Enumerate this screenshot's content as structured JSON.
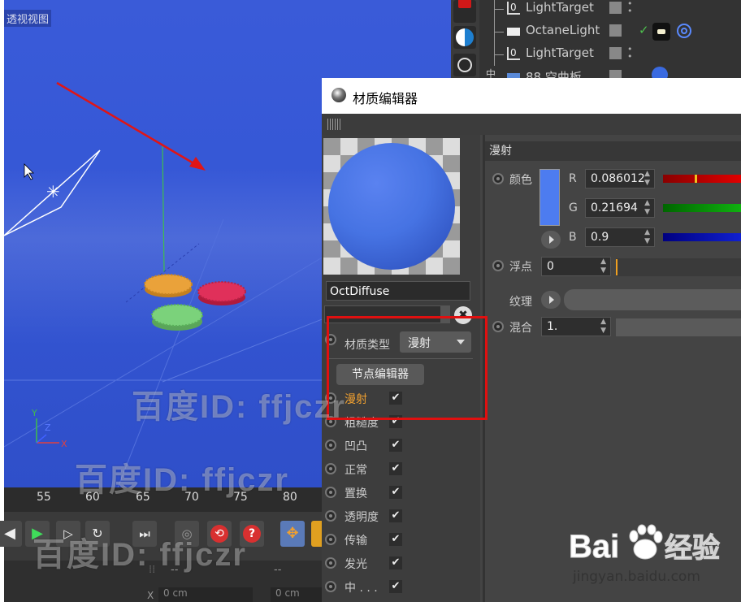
{
  "viewport": {
    "title": "透视视图"
  },
  "timeline": {
    "ticks": [
      "55",
      "60",
      "65",
      "70",
      "75",
      "80"
    ]
  },
  "coords": {
    "x_label": "X",
    "x_value": "0 cm",
    "y_value": "0 cm",
    "dash1": "--",
    "dash2": "--"
  },
  "object_manager": {
    "rows": [
      {
        "label": "LightTarget"
      },
      {
        "label": "OctaneLight"
      },
      {
        "label": "LightTarget"
      },
      {
        "label": "88 空曲板"
      }
    ]
  },
  "material_editor": {
    "title": "材质编辑器",
    "material_name": "OctDiffuse",
    "material_type_label": "材质类型",
    "material_type_value": "漫射",
    "node_editor_button": "节点编辑器",
    "channels": [
      {
        "label": "漫射",
        "checked": "✔"
      },
      {
        "label": "粗糙度",
        "checked": "✔"
      },
      {
        "label": "凹凸",
        "checked": "✔"
      },
      {
        "label": "正常",
        "checked": "✔"
      },
      {
        "label": "置换",
        "checked": "✔"
      },
      {
        "label": "透明度",
        "checked": "✔"
      },
      {
        "label": "传输",
        "checked": "✔"
      },
      {
        "label": "发光",
        "checked": "✔"
      },
      {
        "label": "中 . . .",
        "checked": "✔"
      }
    ],
    "section_title": "漫射",
    "color_label": "颜色",
    "r_label": "R",
    "r_value": "0.086012",
    "g_label": "G",
    "g_value": "0.21694",
    "b_label": "B",
    "b_value": "0.9",
    "float_label": "浮点",
    "float_value": "0",
    "texture_label": "纹理",
    "mix_label": "混合",
    "mix_value": "1."
  },
  "watermark": {
    "text": "百度ID: ffjczr",
    "logo": "Baidu经验",
    "url": "jingyan.baidu.com"
  },
  "colors": {
    "swatch": "#4d7cf0",
    "highlight_red": "#e01010",
    "channel_active": "#f0a030"
  }
}
